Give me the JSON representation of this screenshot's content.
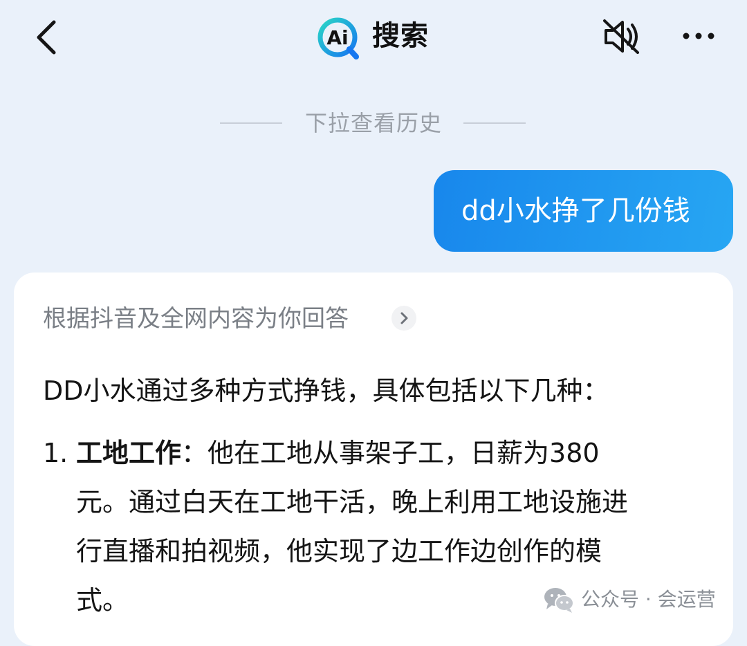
{
  "header": {
    "logo_text": "Ai",
    "title": "搜索",
    "back_icon": "chevron-left-icon",
    "mute_icon": "speaker-muted-icon",
    "more_icon": "ellipsis-icon"
  },
  "history": {
    "label": "下拉查看历史"
  },
  "chat": {
    "user_message": "dd小水挣了几份钱",
    "answer": {
      "source_label": "根据抖音及全网内容为你回答",
      "intro": "DD小水通过多种方式挣钱，具体包括以下几种：",
      "items": [
        {
          "number": "1.",
          "title": "工地工作",
          "line1": "：他在工地从事架子工，日薪为380",
          "line2": "元。通过白天在工地干活，晚上利用工地设施进",
          "line3": "行直播和拍视频，他实现了边工作边创作的模",
          "line4": "式。"
        }
      ]
    }
  },
  "watermark": {
    "text": "公众号 · 会运营"
  },
  "colors": {
    "background": "#eaf1fa",
    "accent_blue": "#1d8ff0",
    "bubble_gradient_start": "#1887ec",
    "bubble_gradient_end": "#27a6f3"
  }
}
